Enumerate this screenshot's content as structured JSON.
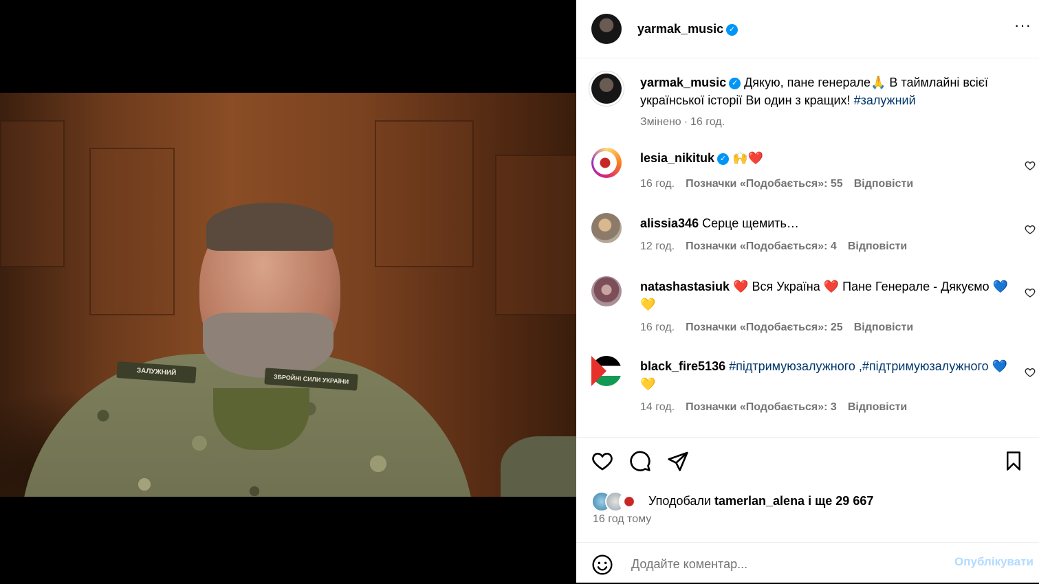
{
  "post": {
    "author": "yarmak_music",
    "caption": "Дякую, пане генерале🙏 В таймлайні всієї української історії Ви один з кращих!",
    "hashtag": "#залужний",
    "edited": "Змінено",
    "caption_time": "16 год.",
    "photo_patch_name": "ЗАЛУЖНИЙ",
    "photo_patch_unit": "ЗБРОЙНІ СИЛИ УКРАЇНИ"
  },
  "comments": [
    {
      "user": "lesia_nikituk",
      "verified": true,
      "text": "🙌❤️",
      "time": "16 год.",
      "likes": "Позначки «Подобається»: 55",
      "reply": "Відповісти"
    },
    {
      "user": "alissia346",
      "verified": false,
      "text": "Серце щемить…",
      "time": "12 год.",
      "likes": "Позначки «Подобається»: 4",
      "reply": "Відповісти"
    },
    {
      "user": "natashastasiuk",
      "verified": false,
      "text": "❤️ Вся Україна ❤️ Пане Генерале - Дякуємо 💙💛",
      "time": "16 год.",
      "likes": "Позначки «Подобається»: 25",
      "reply": "Відповісти"
    },
    {
      "user": "black_fire5136",
      "verified": false,
      "text": "#підтримуюзалужного ,#підтримуюзалужного 💙💛",
      "time": "14 год.",
      "likes": "Позначки «Подобається»: 3",
      "reply": "Відповісти"
    }
  ],
  "likes": {
    "prefix": "Уподобали",
    "user": "tamerlan_alena",
    "suffix": "і ще 29 667"
  },
  "post_time": "16 год тому",
  "comment_box": {
    "placeholder": "Додайте коментар...",
    "publish": "Опублікувати"
  },
  "icons": {
    "more": "more-options-icon",
    "like": "heart-icon",
    "comment": "comment-bubble-icon",
    "share": "paper-plane-icon",
    "save": "bookmark-icon",
    "emoji": "emoji-smiley-icon",
    "verified": "verified-badge-icon"
  },
  "colors": {
    "verified_blue": "#0095f6",
    "hashtag": "#00376b",
    "muted_text": "#737373",
    "publish_disabled": "#b3dbff"
  }
}
